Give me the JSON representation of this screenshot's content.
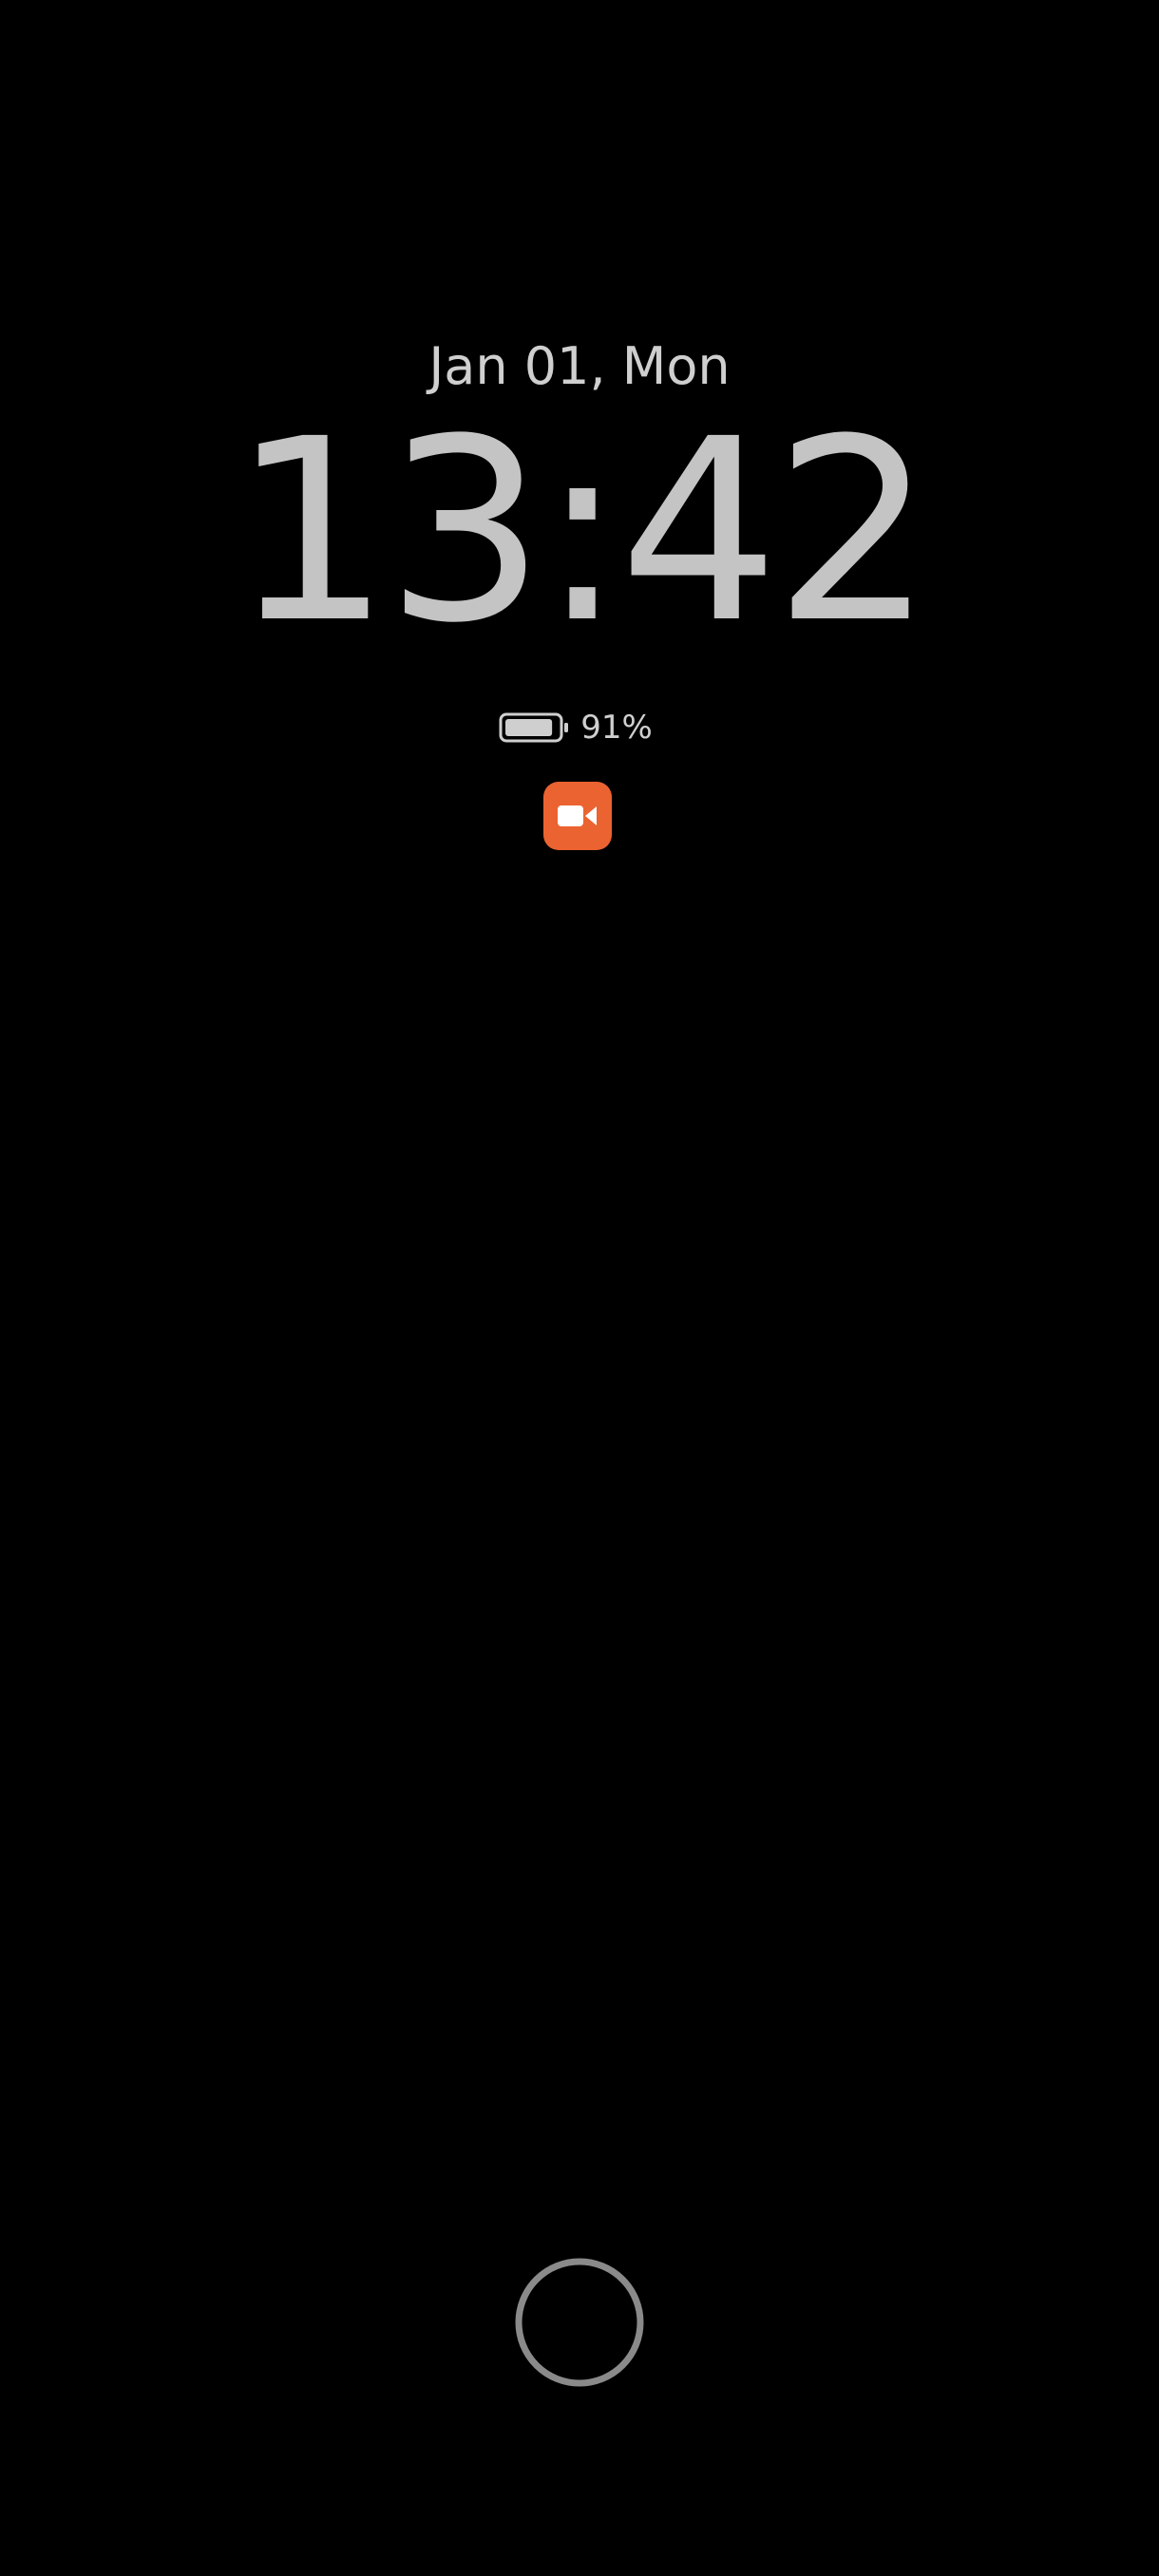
{
  "lock_screen": {
    "date": "Jan 01, Mon",
    "time": "13:42",
    "battery": {
      "level_percent": 91,
      "label": "91%"
    },
    "notification_icons": [
      {
        "icon": "video-camera-icon",
        "accent_color": "#eb6330"
      }
    ],
    "unlock": {
      "icon": "fingerprint-ring-icon"
    }
  },
  "colors": {
    "background": "#000000",
    "text": "#c4c4c4",
    "notification_accent": "#eb6330",
    "ring": "#8a8a8a"
  }
}
